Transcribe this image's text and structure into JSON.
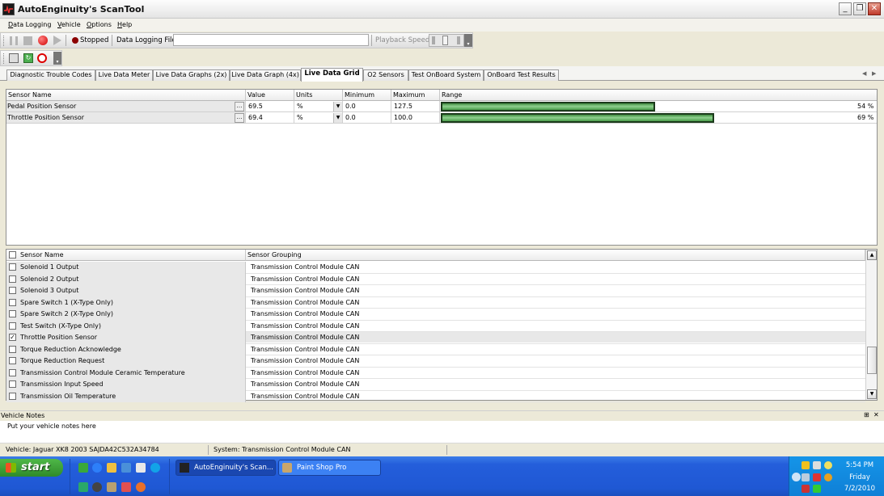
{
  "window": {
    "title": "AutoEnginuity's ScanTool",
    "minimize": "_",
    "maximize": "❐",
    "close": "✕"
  },
  "menu": {
    "items": [
      {
        "pre": "D",
        "rest": "ata Logging"
      },
      {
        "pre": "V",
        "rest": "ehicle"
      },
      {
        "pre": "O",
        "rest": "ptions"
      },
      {
        "pre": "H",
        "rest": "elp"
      }
    ]
  },
  "toolbar": {
    "status": "Stopped",
    "logging_file_label": "Data Logging File",
    "logging_file_value": "",
    "playback_label": "Playback Speed"
  },
  "tabs": [
    "Diagnostic Trouble Codes",
    "Live Data Meter",
    "Live Data Graphs (2x)",
    "Live Data Graph (4x)",
    "Live Data Grid",
    "O2 Sensors",
    "Test OnBoard System",
    "OnBoard Test Results"
  ],
  "active_tab": "Live Data Grid",
  "grid": {
    "headers": [
      "Sensor Name",
      "Value",
      "Units",
      "Minimum",
      "Maximum",
      "Range"
    ],
    "rows": [
      {
        "name": "Pedal Position Sensor",
        "value": "69.5",
        "units": "%",
        "minimum": "0.0",
        "maximum": "127.5",
        "range_fraction": 0.54,
        "range_label": "54 %"
      },
      {
        "name": "Throttle Position Sensor",
        "value": "69.4",
        "units": "%",
        "minimum": "0.0",
        "maximum": "100.0",
        "range_fraction": 0.69,
        "range_label": "69 %"
      }
    ]
  },
  "sensor_list": {
    "headers": [
      "Sensor Name",
      "Sensor Grouping"
    ],
    "rows": [
      {
        "name": "Solenoid 1 Output",
        "group": "Transmission Control Module CAN",
        "checked": false
      },
      {
        "name": "Solenoid 2 Output",
        "group": "Transmission Control Module CAN",
        "checked": false
      },
      {
        "name": "Solenoid 3 Output",
        "group": "Transmission Control Module CAN",
        "checked": false
      },
      {
        "name": "Spare Switch 1 (X-Type Only)",
        "group": "Transmission Control Module CAN",
        "checked": false
      },
      {
        "name": "Spare Switch 2 (X-Type Only)",
        "group": "Transmission Control Module CAN",
        "checked": false
      },
      {
        "name": "Test Switch (X-Type Only)",
        "group": "Transmission Control Module CAN",
        "checked": false
      },
      {
        "name": "Throttle Position Sensor",
        "group": "Transmission Control Module CAN",
        "checked": true
      },
      {
        "name": "Torque Reduction Acknowledge",
        "group": "Transmission Control Module CAN",
        "checked": false
      },
      {
        "name": "Torque Reduction Request",
        "group": "Transmission Control Module CAN",
        "checked": false
      },
      {
        "name": "Transmission Control Module Ceramic Temperature",
        "group": "Transmission Control Module CAN",
        "checked": false
      },
      {
        "name": "Transmission Input Speed",
        "group": "Transmission Control Module CAN",
        "checked": false
      },
      {
        "name": "Transmission Oil Temperature",
        "group": "Transmission Control Module CAN",
        "checked": false
      }
    ]
  },
  "notes": {
    "title": "Vehicle Notes",
    "placeholder": "Put your vehicle notes here",
    "pin": "⊞",
    "close": "✕"
  },
  "status": {
    "vehicle": "Vehicle: Jaguar  XK8  2003  SAJDA42C532A34784",
    "system": "System: Transmission Control Module CAN"
  },
  "taskbar": {
    "start": "start",
    "tasks": [
      "AutoEnginuity's Scan...",
      "Paint Shop Pro"
    ],
    "clock": {
      "time": "5:54 PM",
      "day": "Friday",
      "date": "7/2/2010"
    }
  },
  "colors": {
    "bar_fill": "#5cb85c",
    "title_bar": "#f0f0f0",
    "taskbar": "#245edb",
    "start": "#3c9a37"
  }
}
